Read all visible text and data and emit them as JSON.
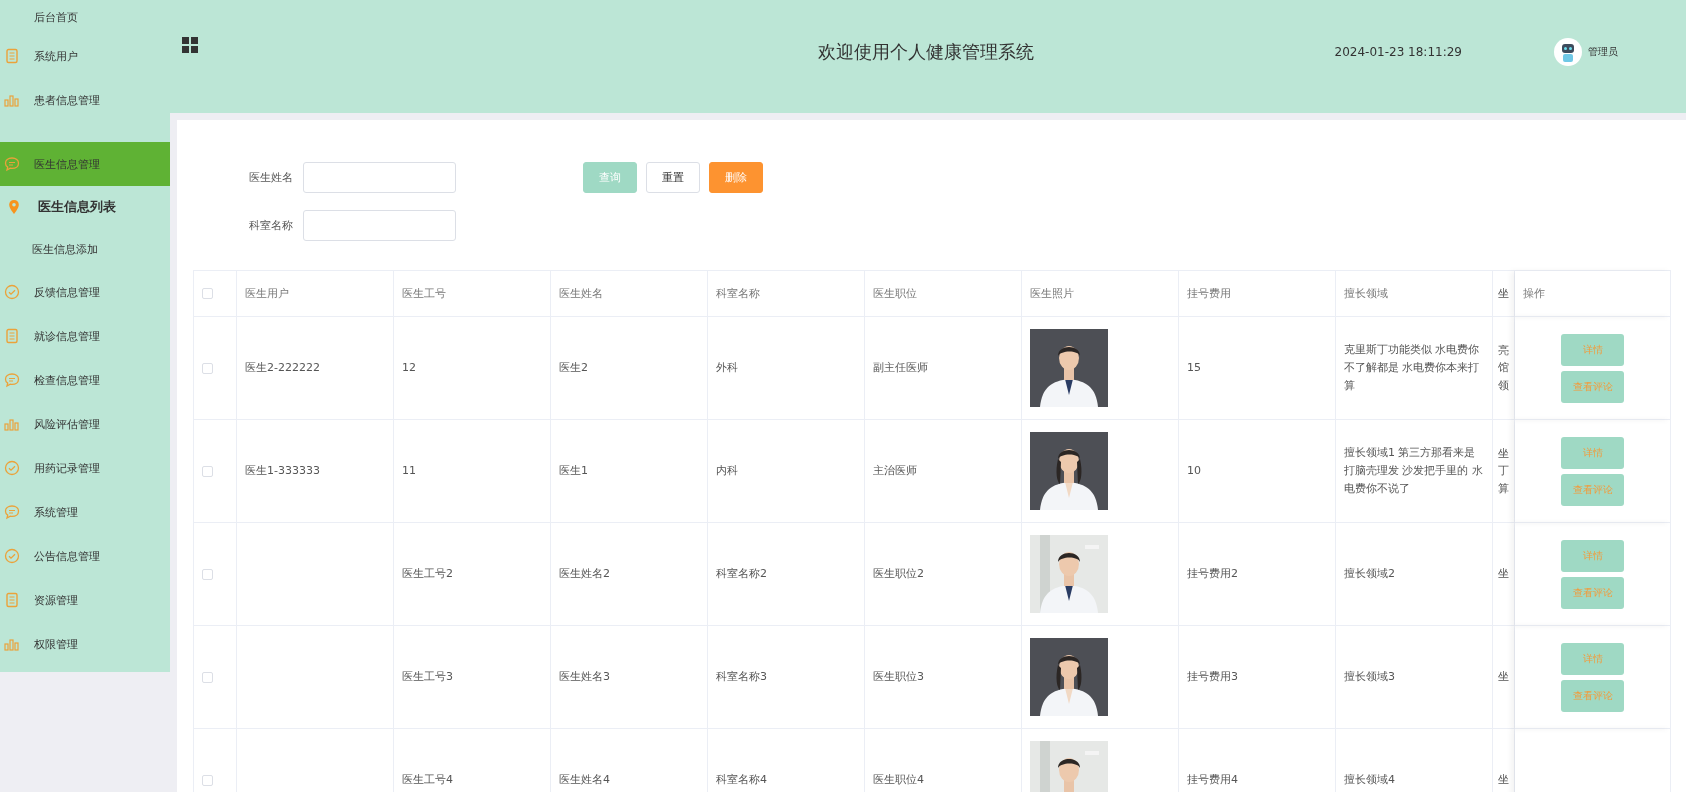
{
  "sidebar": {
    "items": [
      {
        "label": "后台首页",
        "kind": "none",
        "selected": false
      },
      {
        "label": "系统用户",
        "kind": "doc",
        "selected": false
      },
      {
        "label": "患者信息管理",
        "kind": "chart",
        "selected": false
      },
      {
        "label": "医生信息管理",
        "kind": "chat",
        "selected": true,
        "children": [
          {
            "label": "医生信息列表",
            "selected": true
          },
          {
            "label": "医生信息添加",
            "selected": false
          }
        ]
      },
      {
        "label": "反馈信息管理",
        "kind": "check",
        "selected": false
      },
      {
        "label": "就诊信息管理",
        "kind": "doc",
        "selected": false
      },
      {
        "label": "检查信息管理",
        "kind": "chat",
        "selected": false
      },
      {
        "label": "风险评估管理",
        "kind": "chart",
        "selected": false
      },
      {
        "label": "用药记录管理",
        "kind": "check",
        "selected": false
      },
      {
        "label": "系统管理",
        "kind": "chat",
        "selected": false
      },
      {
        "label": "公告信息管理",
        "kind": "check",
        "selected": false
      },
      {
        "label": "资源管理",
        "kind": "doc",
        "selected": false
      },
      {
        "label": "权限管理",
        "kind": "chart",
        "selected": false
      }
    ]
  },
  "header": {
    "title": "欢迎使用个人健康管理系统",
    "datetime": "2024-01-23 18:11:29",
    "user": "管理员"
  },
  "search": {
    "fields": [
      {
        "label": "医生姓名"
      },
      {
        "label": "科室名称"
      }
    ],
    "buttons": [
      {
        "label": "查询",
        "kind": "primary"
      },
      {
        "label": "重置",
        "kind": "plain"
      },
      {
        "label": "删除",
        "kind": "danger"
      }
    ]
  },
  "table": {
    "select_all": {
      "checked": false
    },
    "columns": [
      "医生用户",
      "医生工号",
      "医生姓名",
      "科室名称",
      "医生职位",
      "医生照片",
      "挂号费用",
      "擅长领域",
      "坐",
      "操作"
    ],
    "rows": [
      {
        "checked": false,
        "cells": [
          "医生2-222222",
          "12",
          "医生2",
          "外科",
          "副主任医师",
          {
            "kind": "picture"
          },
          "15",
          "克里斯丁功能类似 水电费你不了解都是 水电费你本来打算",
          "亮馆领"
        ],
        "actions": [
          "详情",
          "查看评论"
        ]
      },
      {
        "checked": false,
        "cells": [
          "医生1-333333",
          "11",
          "医生1",
          "内科",
          "主治医师",
          {
            "kind": "picture"
          },
          "10",
          "擅长领域1 第三方那看来是打脑壳理发 沙发把手里的 水电费你不说了",
          "坐丁算"
        ],
        "actions": [
          "详情",
          "查看评论"
        ]
      },
      {
        "checked": false,
        "cells": [
          "",
          "医生工号2",
          "医生姓名2",
          "科室名称2",
          "医生职位2",
          {
            "kind": "picture"
          },
          "挂号费用2",
          "擅长领域2",
          "坐"
        ],
        "actions": [
          "详情",
          "查看评论"
        ]
      },
      {
        "checked": false,
        "cells": [
          "",
          "医生工号3",
          "医生姓名3",
          "科室名称3",
          "医生职位3",
          {
            "kind": "picture"
          },
          "挂号费用3",
          "擅长领域3",
          "坐"
        ],
        "actions": [
          "详情",
          "查看评论"
        ]
      },
      {
        "checked": false,
        "cells": [
          "",
          "医生工号4",
          "医生姓名4",
          "科室名称4",
          "医生职位4",
          {
            "kind": "picture"
          },
          "挂号费用4",
          "擅长领域4",
          "坐"
        ],
        "actions": []
      }
    ]
  }
}
